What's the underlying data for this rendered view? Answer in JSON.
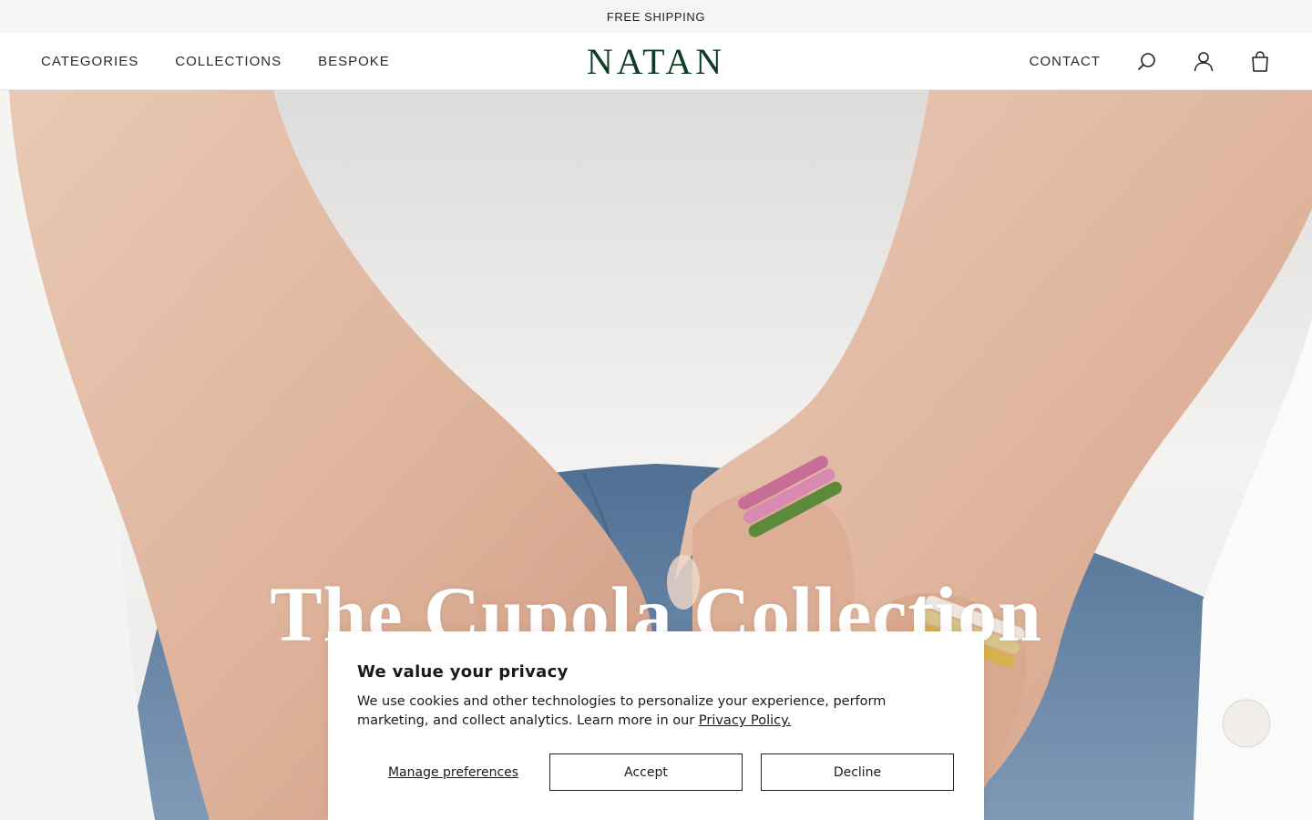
{
  "announcement": {
    "text": "FREE SHIPPING"
  },
  "header": {
    "logo": "NATAN",
    "nav_left": [
      {
        "label": "CATEGORIES"
      },
      {
        "label": "COLLECTIONS"
      },
      {
        "label": "BESPOKE"
      }
    ],
    "contact_label": "CONTACT",
    "icons": [
      "search-icon",
      "account-icon",
      "bag-icon"
    ]
  },
  "hero": {
    "title": "The Cupola Collection",
    "image": "hands-wearing-stacked-rings-photo"
  },
  "cookie_banner": {
    "heading": "We value your privacy",
    "body": "We use cookies and other technologies to personalize your experience, perform marketing, and collect analytics. Learn more in our ",
    "policy_link": "Privacy Policy.",
    "manage_label": "Manage preferences",
    "accept_label": "Accept",
    "decline_label": "Decline"
  },
  "colors": {
    "logo": "#0f3d25",
    "announcement_bg": "#f5f5f5",
    "text": "#1a1a1a"
  }
}
